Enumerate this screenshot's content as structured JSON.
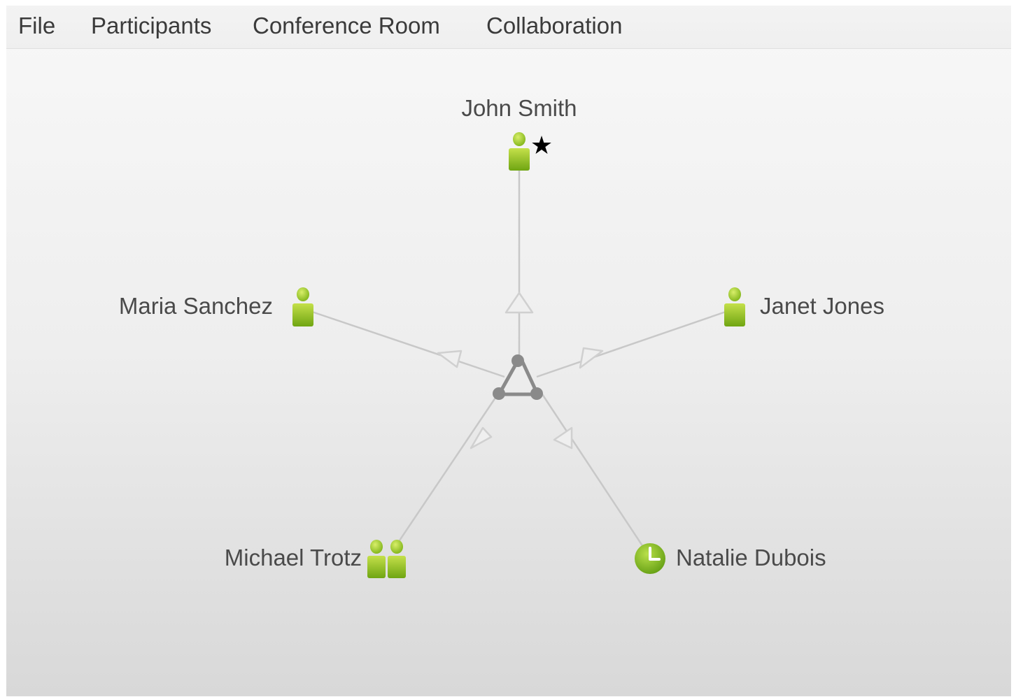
{
  "menu": {
    "file": "File",
    "participants": "Participants",
    "conference_room": "Conference Room",
    "collaboration": "Collaboration"
  },
  "hub": {
    "icon": "conference-hub-icon"
  },
  "participants": [
    {
      "name": "John Smith",
      "icon": "single-user-icon",
      "badge": "★",
      "badge_icon": "star-icon",
      "role": "moderator"
    },
    {
      "name": "Janet Jones",
      "icon": "single-user-icon"
    },
    {
      "name": "Natalie Dubois",
      "icon": "clock-icon",
      "status": "waiting"
    },
    {
      "name": "Michael Trotz",
      "icon": "group-users-icon"
    },
    {
      "name": "Maria Sanchez",
      "icon": "single-user-icon"
    }
  ],
  "colors": {
    "icon_green_light": "#b6d83a",
    "icon_green_dark": "#6fa512",
    "connector": "#c8c8c8",
    "hub_node": "#8a8a8a",
    "label_text": "#4a4a4a"
  }
}
